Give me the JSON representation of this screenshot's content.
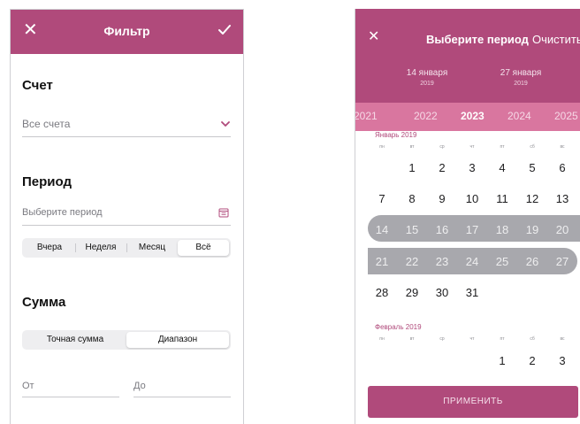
{
  "filter": {
    "title": "Фильтр",
    "account": {
      "section": "Счет",
      "value": "Все счета"
    },
    "period": {
      "section": "Период",
      "placeholder": "Выберите период",
      "options": [
        "Вчера",
        "Неделя",
        "Месяц",
        "Всё"
      ],
      "selected": "Всё"
    },
    "sum": {
      "section": "Сумма",
      "options": [
        "Точная сумма",
        "Диапазон"
      ],
      "selected": "Диапазон",
      "from_placeholder": "От",
      "to_placeholder": "До"
    },
    "icons": {
      "close": "close-icon",
      "confirm": "check-icon",
      "dropdown": "chevron-down-icon",
      "calendar": "calendar-icon"
    }
  },
  "picker": {
    "title": "Выберите период",
    "clear": "Очистить",
    "start": {
      "date": "14 января",
      "year": "2019"
    },
    "end": {
      "date": "27 января",
      "year": "2019"
    },
    "years": [
      "2021",
      "2022",
      "2023",
      "2024",
      "2025"
    ],
    "current_year": "2023",
    "weekdays": [
      "пн",
      "вт",
      "ср",
      "чт",
      "пт",
      "сб",
      "вс"
    ],
    "months": [
      {
        "label": "Январь  2019",
        "weeks": [
          [
            "",
            "1",
            "2",
            "3",
            "4",
            "5",
            "6"
          ],
          [
            "7",
            "8",
            "9",
            "10",
            "11",
            "12",
            "13"
          ],
          [
            "14",
            "15",
            "16",
            "17",
            "18",
            "19",
            "20"
          ],
          [
            "21",
            "22",
            "23",
            "24",
            "25",
            "26",
            "27"
          ],
          [
            "28",
            "29",
            "30",
            "31",
            "",
            "",
            ""
          ]
        ]
      },
      {
        "label": "Февраль  2019",
        "weeks": [
          [
            "",
            "",
            "",
            "",
            "1",
            "2",
            "3"
          ]
        ]
      }
    ],
    "selected_range": [
      "14",
      "27"
    ],
    "apply": "ПРИМЕНИТЬ"
  },
  "colors": {
    "accent": "#b04a7b",
    "year_bar": "#d9769f",
    "range_band": "#a8a8ad"
  }
}
